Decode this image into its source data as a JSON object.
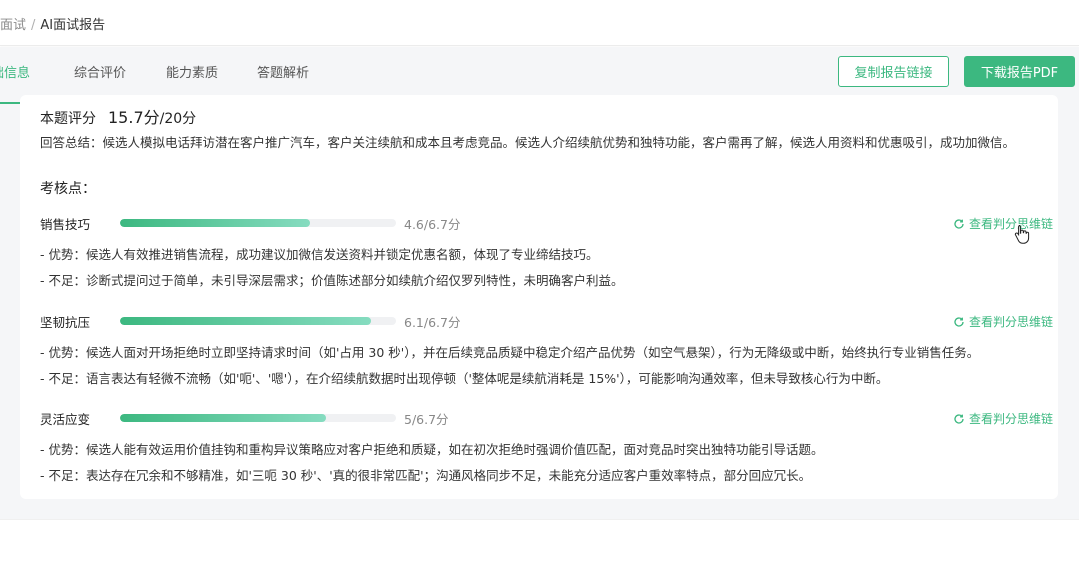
{
  "breadcrumb": {
    "prev": "面试",
    "separator": "/",
    "current": "AI面试报告"
  },
  "tabs": [
    {
      "label": "基础信息",
      "active": true
    },
    {
      "label": "综合评价",
      "active": false
    },
    {
      "label": "能力素质",
      "active": false
    },
    {
      "label": "答题解析",
      "active": false
    }
  ],
  "actions": {
    "copy_label": "复制报告链接",
    "pdf_label": "下载报告PDF"
  },
  "question": {
    "score_label": "本题评分",
    "score_value": "15.7分",
    "score_total": "/20分",
    "summary": "回答总结：候选人模拟电话拜访潜在客户推广汽车，客户关注续航和成本且考虑竞品。候选人介绍续航优势和独特功能，客户需再了解，候选人用资料和优惠吸引，成功加微信。",
    "section_title": "考核点："
  },
  "assessments": [
    {
      "name": "销售技巧",
      "score_text": "4.6/6.7分",
      "progress": 0.687,
      "link": "查看判分思维链",
      "strength": "- 优势：候选人有效推进销售流程，成功建议加微信发送资料并锁定优惠名额，体现了专业缔结技巧。",
      "weakness": "- 不足：诊断式提问过于简单，未引导深层需求；价值陈述部分如续航介绍仅罗列特性，未明确客户利益。"
    },
    {
      "name": "坚韧抗压",
      "score_text": "6.1/6.7分",
      "progress": 0.91,
      "link": "查看判分思维链",
      "strength": "- 优势：候选人面对开场拒绝时立即坚持请求时间（如'占用 30 秒'），并在后续竞品质疑中稳定介绍产品优势（如空气悬架），行为无降级或中断，始终执行专业销售任务。",
      "weakness": "- 不足：语言表达有轻微不流畅（如'呃'、'嗯'），在介绍续航数据时出现停顿（'整体呢是续航消耗是 15%'），可能影响沟通效率，但未导致核心行为中断。"
    },
    {
      "name": "灵活应变",
      "score_text": "5/6.7分",
      "progress": 0.746,
      "link": "查看判分思维链",
      "strength": "- 优势：候选人能有效运用价值挂钩和重构异议策略应对客户拒绝和质疑，如在初次拒绝时强调价值匹配，面对竞品时突出独特功能引导话题。",
      "weakness": "- 不足：表达存在冗余和不够精准，如'三呃 30 秒'、'真的很非常匹配'；沟通风格同步不足，未能充分适应客户重效率特点，部分回应冗长。"
    }
  ],
  "colors": {
    "accent": "#3cb880",
    "bar_end": "#86dcc0",
    "page_bg": "#f5f6f8"
  }
}
